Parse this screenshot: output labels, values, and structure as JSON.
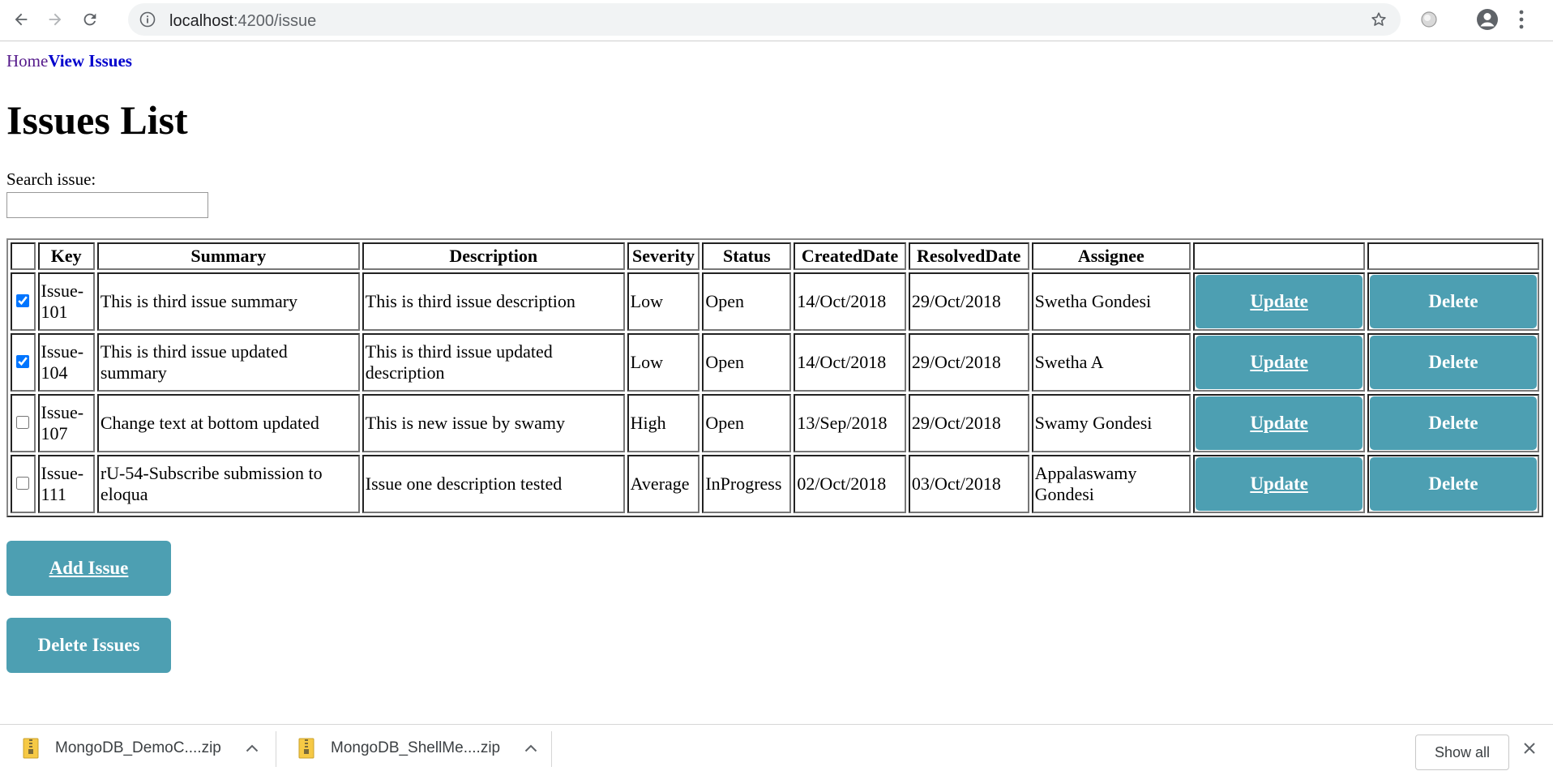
{
  "browser": {
    "url_host": "localhost",
    "url_path": ":4200/issue"
  },
  "nav": {
    "home": "Home",
    "view_issues": "View Issues"
  },
  "page_title": "Issues List",
  "search": {
    "label": "Search issue:",
    "value": "",
    "placeholder": ""
  },
  "table": {
    "headers": [
      "",
      "Key",
      "Summary",
      "Description",
      "Severity",
      "Status",
      "CreatedDate",
      "ResolvedDate",
      "Assignee",
      "",
      ""
    ],
    "update_label": "Update",
    "delete_label": "Delete",
    "rows": [
      {
        "checked": true,
        "key": "Issue-101",
        "summary": "This is third issue summary",
        "description": "This is third issue description",
        "severity": "Low",
        "status": "Open",
        "created": "14/Oct/2018",
        "resolved": "29/Oct/2018",
        "assignee": "Swetha Gondesi"
      },
      {
        "checked": true,
        "key": "Issue-104",
        "summary": "This is third issue updated summary",
        "description": "This is third issue updated description",
        "severity": "Low",
        "status": "Open",
        "created": "14/Oct/2018",
        "resolved": "29/Oct/2018",
        "assignee": "Swetha A"
      },
      {
        "checked": false,
        "key": "Issue-107",
        "summary": "Change text at bottom updated",
        "description": "This is new issue by swamy",
        "severity": "High",
        "status": "Open",
        "created": "13/Sep/2018",
        "resolved": "29/Oct/2018",
        "assignee": "Swamy Gondesi"
      },
      {
        "checked": false,
        "key": "Issue-111",
        "summary": "rU-54-Subscribe submission to eloqua",
        "description": "Issue one description tested",
        "severity": "Average",
        "status": "InProgress",
        "created": "02/Oct/2018",
        "resolved": "03/Oct/2018",
        "assignee": "Appalaswamy Gondesi"
      }
    ]
  },
  "actions": {
    "add_issue": "Add Issue",
    "delete_issues": "Delete Issues"
  },
  "downloads": {
    "items": [
      {
        "name": "MongoDB_DemoC....zip"
      },
      {
        "name": "MongoDB_ShellMe....zip"
      }
    ],
    "show_all": "Show all"
  },
  "colors": {
    "button_bg": "#4d9fb2",
    "visited_link": "#551a8b",
    "active_link": "#0000cc"
  },
  "icons": [
    "back-arrow-icon",
    "forward-arrow-icon",
    "reload-icon",
    "info-icon",
    "star-icon",
    "extension-icon",
    "account-icon",
    "menu-dots-icon",
    "zip-file-icon",
    "chevron-up-icon",
    "close-icon"
  ]
}
